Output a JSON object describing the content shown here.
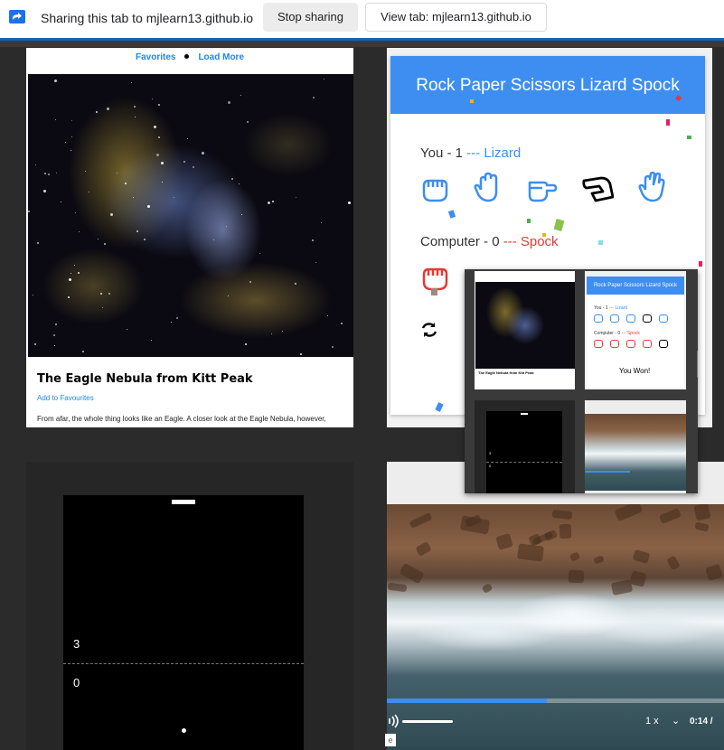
{
  "share_bar": {
    "icon": "screen-share-icon",
    "text": "Sharing this tab to mjlearn13.github.io",
    "stop_label": "Stop sharing",
    "view_label": "View tab: mjlearn13.github.io",
    "accent": "#1a73e8"
  },
  "apod": {
    "nav_favorites": "Favorites",
    "nav_load_more": "Load More",
    "title": "The Eagle Nebula from Kitt Peak",
    "add_favourites": "Add to Favourites",
    "description": "From afar, the whole thing looks like an Eagle. A closer look at the Eagle Nebula, however,"
  },
  "rps": {
    "header": "Rock Paper Scissors Lizard Spock",
    "you_label": "You - 1",
    "you_choice": "--- Lizard",
    "computer_label": "Computer - 0",
    "computer_choice": "--- Spock",
    "accent": "#3d8ef0",
    "loss_color": "#e53935",
    "refresh_icon": "refresh-icon"
  },
  "pong": {
    "score_top": "3",
    "score_bottom": "0"
  },
  "video": {
    "speed": "1 x",
    "time": "0:14 /",
    "progress": 0.475,
    "edge_label": "e"
  },
  "mini_preview": {
    "rps_header": "Rock Paper Scissors Lizard Spock",
    "you_label": "You - 1",
    "you_choice": "--- Lizard",
    "computer_label": "Computer - 0",
    "computer_choice": "--- Spock",
    "won_text": "You Won!",
    "apod_title": "The Eagle Nebula from Kitt Peak",
    "score_top": "3",
    "score_bottom": "0"
  }
}
